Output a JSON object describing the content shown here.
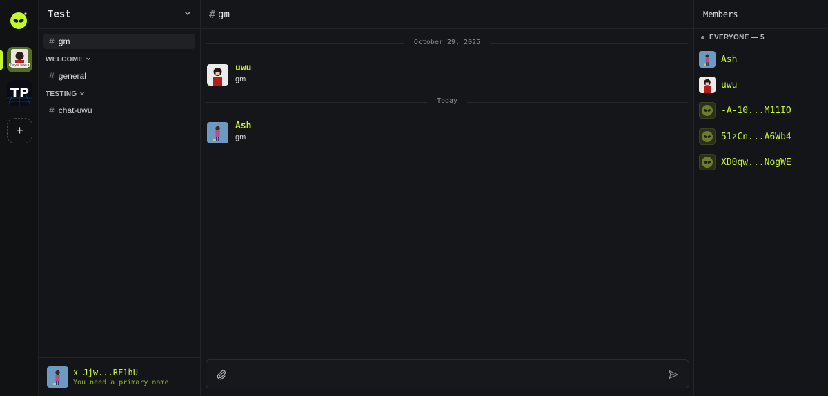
{
  "server_rail": {
    "servers": [
      {
        "name": "Test",
        "badge_text": "Do you have a"
      },
      {
        "name": "TP",
        "label": "TP"
      }
    ],
    "add_label": "+"
  },
  "sidebar": {
    "server_name": "Test",
    "channels_top": [
      {
        "label": "gm",
        "active": true
      }
    ],
    "categories": [
      {
        "label": "WELCOME",
        "channels": [
          {
            "label": "general"
          }
        ]
      },
      {
        "label": "TESTING",
        "channels": [
          {
            "label": "chat-uwu"
          }
        ]
      }
    ],
    "user": {
      "name": "x_Jjw...RF1hU",
      "status": "You need a primary name"
    }
  },
  "main": {
    "channel": "gm",
    "dividers": [
      "October 29, 2025",
      "Today"
    ],
    "messages": [
      {
        "author": "uwu",
        "text": "gm"
      },
      {
        "author": "Ash",
        "text": "gm"
      }
    ]
  },
  "members": {
    "title": "Members",
    "role": "EVERYONE — 5",
    "list": [
      {
        "name": "Ash"
      },
      {
        "name": "uwu"
      },
      {
        "name": "-A-10...M11IO"
      },
      {
        "name": "51zCn...A6Wb4"
      },
      {
        "name": "XD0qw...NogWE"
      }
    ]
  },
  "colors": {
    "accent": "#c4f82a",
    "background": "#151619"
  }
}
